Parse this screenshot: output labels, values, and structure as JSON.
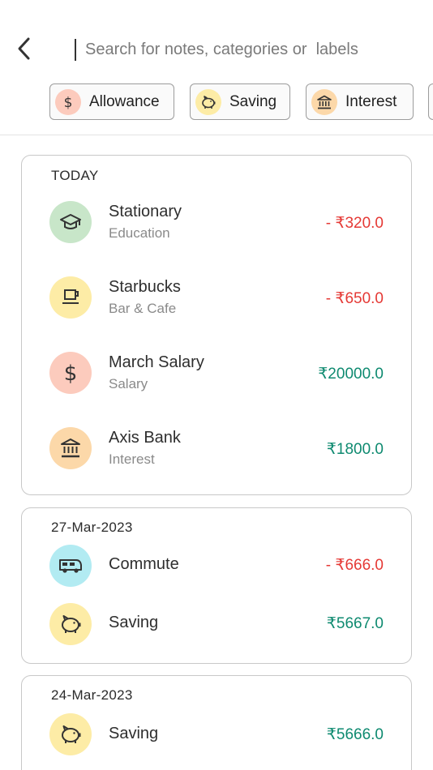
{
  "colors": {
    "negative": "#e53935",
    "positive": "#0e8a70",
    "education_bg": "#c8e6c9",
    "cafe_bg": "#fdeca6",
    "salary_bg": "#fccbbd",
    "interest_bg": "#fcd8a9",
    "commute_bg": "#b2ebf2",
    "saving_bg": "#fdeca6"
  },
  "search": {
    "placeholder": "Search for notes, categories or  labels"
  },
  "chips": [
    {
      "label": "Allowance",
      "icon": "dollar-icon"
    },
    {
      "label": "Saving",
      "icon": "piggy-bank-icon"
    },
    {
      "label": "Interest",
      "icon": "bank-icon"
    }
  ],
  "groups": [
    {
      "date": "TODAY",
      "items": [
        {
          "name": "Stationary",
          "category": "Education",
          "amount": "- ₹320.0",
          "icon": "graduation-cap-icon"
        },
        {
          "name": "Starbucks",
          "category": "Bar & Cafe",
          "amount": "- ₹650.0",
          "icon": "coffee-cup-icon"
        },
        {
          "name": "March Salary",
          "category": "Salary",
          "amount": "₹20000.0",
          "icon": "dollar-icon"
        },
        {
          "name": "Axis Bank",
          "category": "Interest",
          "amount": "₹1800.0",
          "icon": "bank-icon"
        }
      ]
    },
    {
      "date": "27-Mar-2023",
      "items": [
        {
          "name": "Commute",
          "amount": "- ₹666.0",
          "icon": "bus-icon"
        },
        {
          "name": "Saving",
          "amount": "₹5667.0",
          "icon": "piggy-bank-icon"
        }
      ]
    },
    {
      "date": "24-Mar-2023",
      "items": [
        {
          "name": "Saving",
          "amount": "₹5666.0",
          "icon": "piggy-bank-icon"
        }
      ]
    }
  ]
}
